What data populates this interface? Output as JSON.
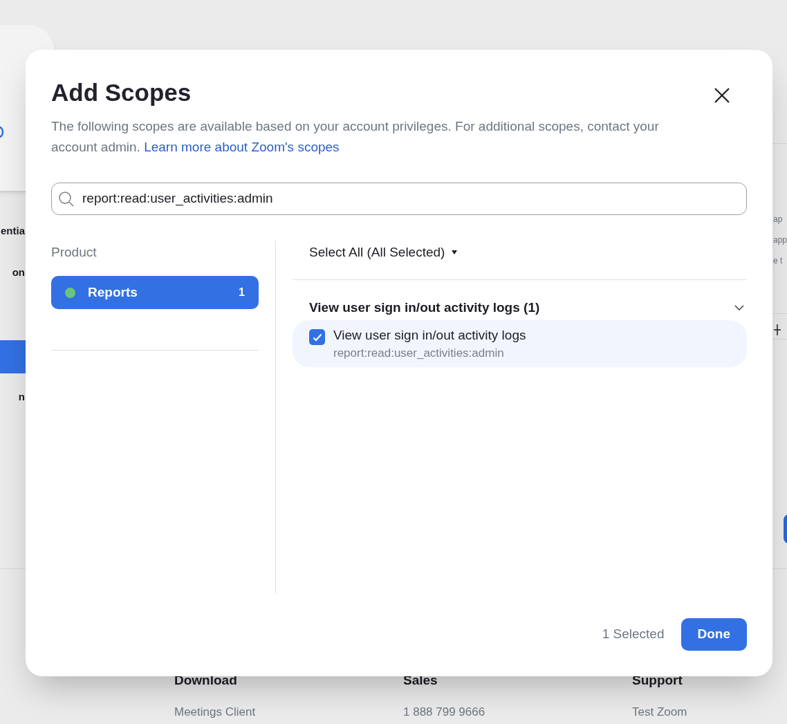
{
  "background": {
    "left_fragments": [
      "entia",
      "on",
      "n"
    ],
    "right_fragments": [
      "ap",
      "app",
      "e t"
    ],
    "footer": [
      {
        "heading": "Download",
        "link": "Meetings Client"
      },
      {
        "heading": "Sales",
        "link": "1 888 799 9666"
      },
      {
        "heading": "Support",
        "link": "Test Zoom"
      }
    ]
  },
  "dialog": {
    "title": "Add Scopes",
    "description": "The following scopes are available based on your account privileges. For additional scopes, contact your account admin.",
    "link": "Learn more about Zoom's scopes",
    "search": {
      "value": "report:read:user_activities:admin"
    },
    "product_heading": "Product",
    "products": [
      {
        "name": "Reports",
        "count": "1",
        "selected": true,
        "color": "#6cc57a"
      }
    ],
    "select_all": "Select All (All Selected)",
    "groups": [
      {
        "title": "View user sign in/out activity logs (1)",
        "expanded": true,
        "scopes": [
          {
            "name": "View user sign in/out activity logs",
            "scope": "report:read:user_activities:admin",
            "checked": true
          }
        ]
      }
    ],
    "selected_count": "1 Selected",
    "done": "Done"
  }
}
